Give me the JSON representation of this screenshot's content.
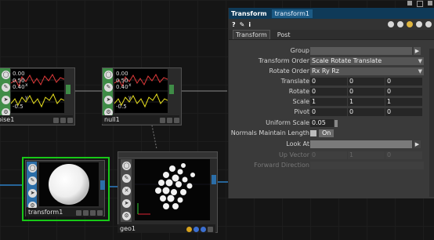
{
  "nodes": {
    "noise": {
      "label": "oise1",
      "chart_vals": [
        "0.00",
        "0.50",
        "0.40",
        "-0.5"
      ],
      "axis_letters": [
        "x",
        "y"
      ]
    },
    "null": {
      "label": "null1",
      "chart_vals": [
        "0.00",
        "0.50",
        "0.40",
        "-0.5"
      ],
      "axis_letters": [
        "x",
        "y"
      ]
    },
    "transform": {
      "label": "transform1"
    },
    "geo": {
      "label": "geo1"
    }
  },
  "panel": {
    "op_type": "Transform",
    "op_name": "transform1",
    "tools": [
      "?",
      "✎",
      "i"
    ],
    "tabs": [
      "Transform",
      "Post"
    ],
    "params": {
      "group": {
        "label": "Group",
        "value": ""
      },
      "transform_order": {
        "label": "Transform Order",
        "value": "Scale Rotate Translate"
      },
      "rotate_order": {
        "label": "Rotate Order",
        "value": "Rx Ry Rz"
      },
      "translate": {
        "label": "Translate",
        "values": [
          "0",
          "0",
          "0"
        ]
      },
      "rotate": {
        "label": "Rotate",
        "values": [
          "0",
          "0",
          "0"
        ]
      },
      "scale": {
        "label": "Scale",
        "values": [
          "1",
          "1",
          "1"
        ]
      },
      "pivot": {
        "label": "Pivot",
        "values": [
          "0",
          "0",
          "0"
        ]
      },
      "uniform_scale": {
        "label": "Uniform Scale",
        "value": "0.05"
      },
      "normals_maintain": {
        "label": "Normals Maintain Length",
        "value": "On"
      },
      "look_at": {
        "label": "Look At",
        "value": ""
      },
      "up_vector": {
        "label": "Up Vector",
        "values": [
          "0",
          "1",
          "0"
        ]
      },
      "forward_direction": {
        "label": "Forward Direction",
        "value": ""
      }
    }
  },
  "colors": {
    "panel_header": "#0f3a58",
    "selected_node": "#18c818",
    "chop_side": "#3f8c47",
    "sop_side": "#2b6ea8",
    "chart_red": "#e23a3a",
    "chart_yellow": "#e8e01e"
  }
}
